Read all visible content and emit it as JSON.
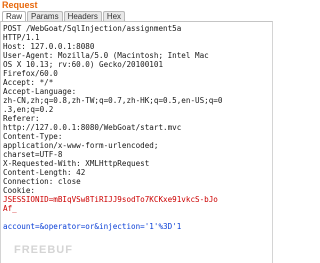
{
  "panel": {
    "title": "Request",
    "tabs": [
      "Raw",
      "Params",
      "Headers",
      "Hex"
    ]
  },
  "request_lines": [
    "POST /WebGoat/SqlInjection/assignment5a",
    "HTTP/1.1",
    "Host: 127.0.0.1:8080",
    "User-Agent: Mozilla/5.0 (Macintosh; Intel Mac",
    "OS X 10.13; rv:60.0) Gecko/20100101",
    "Firefox/60.0",
    "Accept: */*",
    "Accept-Language:",
    "zh-CN,zh;q=0.8,zh-TW;q=0.7,zh-HK;q=0.5,en-US;q=0",
    ".3,en;q=0.2",
    "Referer:",
    "http://127.0.0.1:8080/WebGoat/start.mvc",
    "Content-Type:",
    "application/x-www-form-urlencoded;",
    "charset=UTF-8",
    "X-Requested-With: XMLHttpRequest",
    "Content-Length: 42",
    "Connection: close",
    "Cookie:"
  ],
  "cookie_lines": [
    "JSESSIONID=mBIqVSw8TiRIJJ9sodTo7KCKxe91vkcS-bJo",
    "Af_"
  ],
  "body_line": "account=&operator=or&injection='1'%3D'1",
  "watermark": "FREEBUF"
}
